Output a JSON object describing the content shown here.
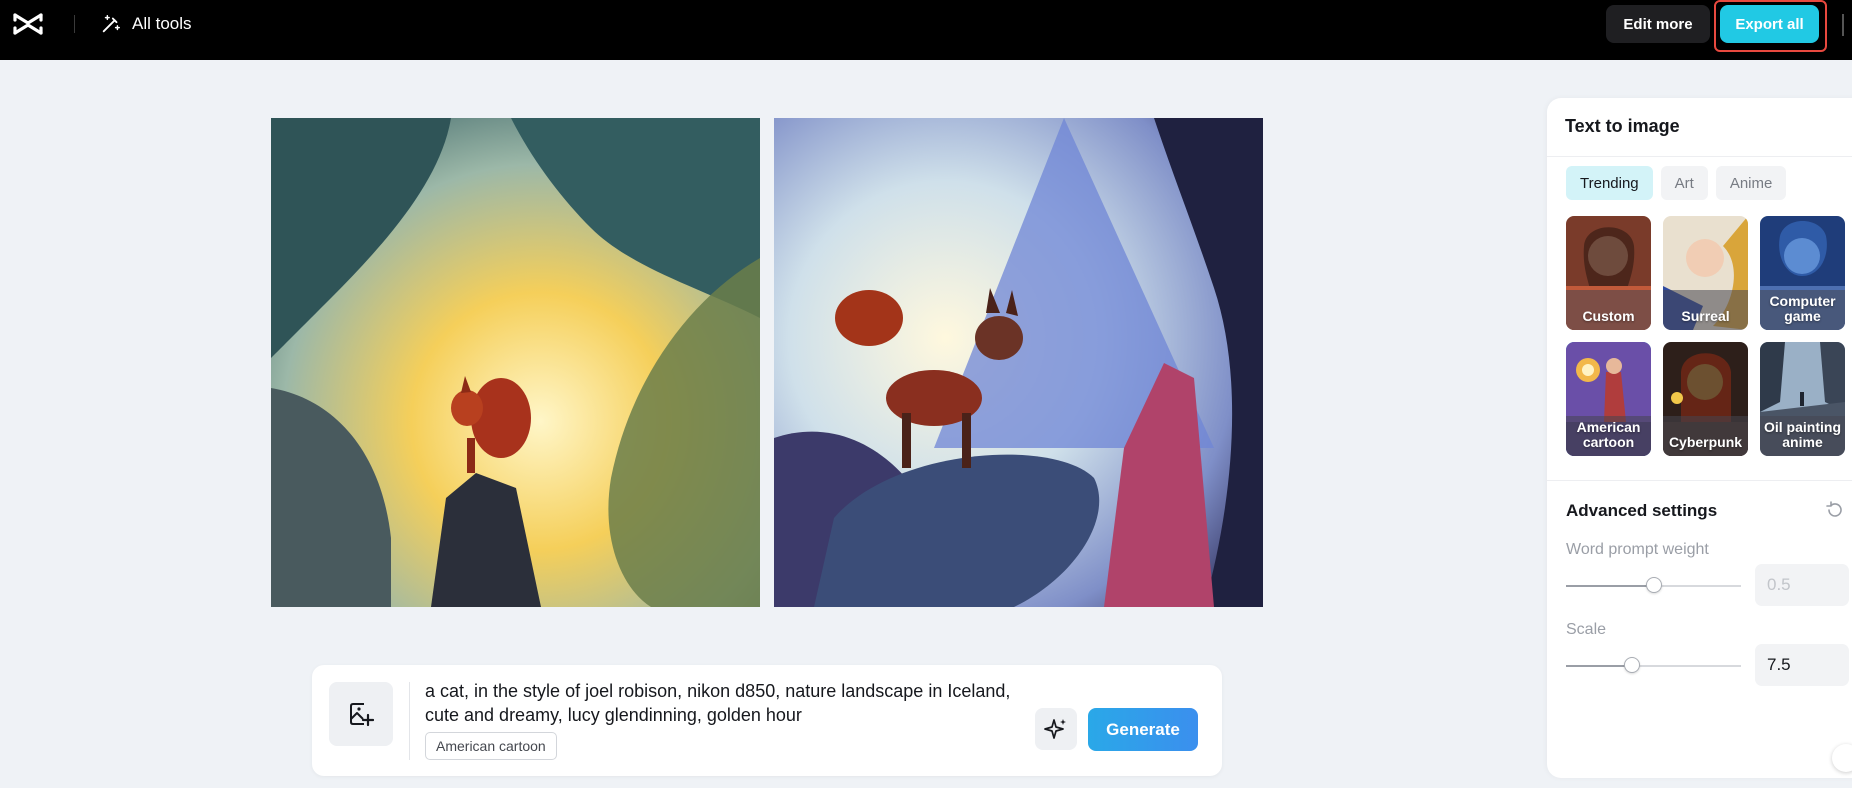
{
  "header": {
    "all_tools_label": "All tools",
    "edit_more_label": "Edit more",
    "export_all_label": "Export all"
  },
  "prompt": {
    "text": "a cat, in the style of joel robison, nikon d850, nature landscape in Iceland, cute and dreamy, lucy glendinning, golden hour",
    "style_tag": "American cartoon",
    "generate_label": "Generate"
  },
  "panel": {
    "title": "Text to image",
    "tabs": [
      {
        "label": "Trending",
        "active": true
      },
      {
        "label": "Art",
        "active": false
      },
      {
        "label": "Anime",
        "active": false
      }
    ],
    "styles": [
      {
        "label": "Custom",
        "selected": false
      },
      {
        "label": "Surreal",
        "selected": false
      },
      {
        "label": "Computer game",
        "selected": false
      },
      {
        "label": "American cartoon",
        "selected": true
      },
      {
        "label": "Cyberpunk",
        "selected": false
      },
      {
        "label": "Oil painting anime",
        "selected": false
      }
    ],
    "advanced": {
      "title": "Advanced settings",
      "word_prompt_weight": {
        "label": "Word prompt weight",
        "value": "0.5",
        "fraction": 0.5
      },
      "scale": {
        "label": "Scale",
        "value": "7.5",
        "fraction": 0.375
      }
    }
  },
  "colors": {
    "accent": "#21c9e4",
    "generate": "#3b8fee",
    "export_highlight": "#e8493f",
    "topbar": "#000000",
    "canvas_bg": "#eff2f6"
  }
}
